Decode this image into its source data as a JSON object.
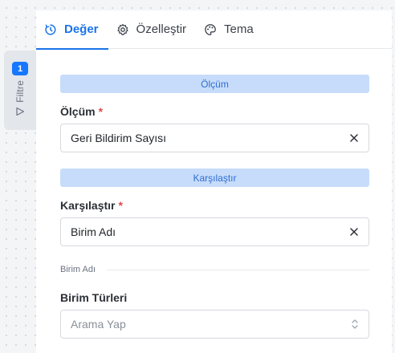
{
  "filter_tab": {
    "count": "1",
    "label": "Filtre"
  },
  "tabs": [
    {
      "label": "Değer",
      "icon": "refresh-clock-icon",
      "active": true
    },
    {
      "label": "Özelleştir",
      "icon": "gear-icon",
      "active": false
    },
    {
      "label": "Tema",
      "icon": "palette-icon",
      "active": false
    }
  ],
  "measure_section": {
    "header": "Ölçüm",
    "field_label": "Ölçüm",
    "required_mark": "*",
    "value": "Geri Bildirim Sayısı"
  },
  "compare_section": {
    "header": "Karşılaştır",
    "field_label": "Karşılaştır",
    "required_mark": "*",
    "value": "Birim Adı"
  },
  "group_divider": {
    "label": "Birim Adı"
  },
  "unit_types": {
    "field_label": "Birim Türleri",
    "placeholder": "Arama Yap"
  },
  "colors": {
    "accent": "#1a73e8",
    "section_bar": "#c7dcfb",
    "required": "#e5484d",
    "badge": "#1677ff"
  }
}
